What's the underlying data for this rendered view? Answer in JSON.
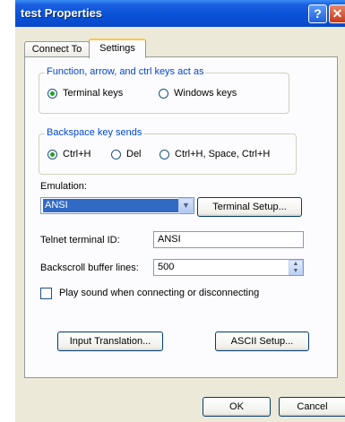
{
  "window": {
    "title": "test Properties"
  },
  "titlebar": {
    "help_label": "?",
    "close_label": "✕"
  },
  "tabs": [
    "Connect To",
    "Settings"
  ],
  "function_keys": {
    "legend": "Function, arrow, and ctrl keys act as",
    "options": [
      {
        "label": "Terminal keys",
        "selected": true
      },
      {
        "label": "Windows keys",
        "selected": false
      }
    ]
  },
  "backspace": {
    "legend": "Backspace key sends",
    "options": [
      {
        "label": "Ctrl+H",
        "selected": true
      },
      {
        "label": "Del",
        "selected": false
      },
      {
        "label": "Ctrl+H, Space, Ctrl+H",
        "selected": false
      }
    ]
  },
  "emulation": {
    "label": "Emulation:",
    "value": "ANSI",
    "dropdown_icon": "chevron-down-icon",
    "setup_button": "Terminal Setup..."
  },
  "telnet": {
    "label": "Telnet terminal ID:",
    "value": "ANSI"
  },
  "backscroll": {
    "label": "Backscroll buffer lines:",
    "value": "500",
    "spin_up": "▲",
    "spin_down": "▼"
  },
  "play_sound": {
    "label": "Play sound when connecting or disconnecting",
    "checked": false
  },
  "buttons": {
    "input_translation": "Input Translation...",
    "ascii_setup": "ASCII Setup...",
    "ok": "OK",
    "cancel": "Cancel"
  },
  "colors": {
    "title_bar": "#0a52d8",
    "selection": "#316ac5",
    "legend": "#0046d5",
    "radio_dot": "#21a121"
  }
}
